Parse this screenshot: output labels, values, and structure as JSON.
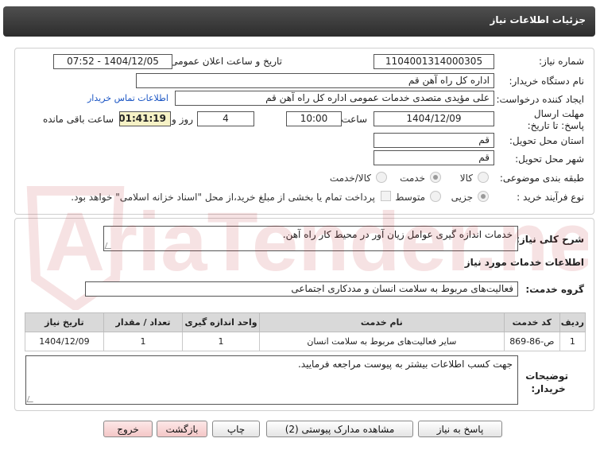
{
  "header": {
    "title": "جزئیات اطلاعات نیاز"
  },
  "form": {
    "need_number": {
      "label": "شماره نیاز:",
      "value": "1104001314000305"
    },
    "announce_datetime": {
      "label": "تاریخ و ساعت اعلان عمومی:",
      "value": "1404/12/05 - 07:52"
    },
    "buyer_org": {
      "label": "نام دستگاه خریدار:",
      "value": "اداره کل  راه آهن قم"
    },
    "requester": {
      "label": "ایجاد کننده درخواست:",
      "value": "علی مؤیدی متصدی خدمات عمومی اداره کل  راه آهن قم",
      "contact_link": "اطلاعات تماس خریدار"
    },
    "deadline": {
      "label": "مهلت ارسال پاسخ: تا تاریخ:",
      "date": "1404/12/09",
      "time_label": "ساعت",
      "time": "10:00",
      "days": "4",
      "days_label": "روز و",
      "remaining": "01:41:19",
      "remaining_label": "ساعت باقی مانده"
    },
    "province": {
      "label": "استان محل تحویل:",
      "value": "قم"
    },
    "city": {
      "label": "شهر محل تحویل:",
      "value": "قم"
    },
    "category": {
      "label": "طبقه بندی موضوعی:",
      "options": [
        "کالا",
        "خدمت",
        "کالا/خدمت"
      ],
      "selected": "خدمت"
    },
    "process": {
      "label": "نوع فرآیند خرید :",
      "options": [
        "جزیی",
        "متوسط"
      ],
      "selected": "جزیی",
      "payment_note": "پرداخت تمام یا بخشی از مبلغ خرید،از محل \"اسناد خزانه اسلامی\" خواهد بود."
    }
  },
  "need_desc": {
    "label": "شرح کلی نیاز:",
    "value": "خدمات اندازه گیری عوامل زیان آور در محیط کار راه آهن."
  },
  "services": {
    "section_title": "اطلاعات خدمات مورد نیاز",
    "group_label": "گروه خدمت:",
    "group_value": "فعالیت‌های مربوط به سلامت انسان و مددکاری اجتماعی",
    "columns": [
      "ردیف",
      "کد خدمت",
      "نام خدمت",
      "واحد اندازه گیری",
      "تعداد / مقدار",
      "تاریخ نیاز"
    ],
    "rows": [
      [
        "1",
        "ص-86-869",
        "سایر فعالیت‌های مربوط به سلامت انسان",
        "1",
        "1",
        "1404/12/09"
      ]
    ]
  },
  "buyer_notes": {
    "label": "توضیحات خریدار:",
    "value": "جهت کسب اطلاعات بیشتر به پیوست مراجعه فرمایید."
  },
  "buttons": {
    "reply": "پاسخ به نیاز",
    "docs": "مشاهده مدارک پیوستی (2)",
    "print": "چاپ",
    "back": "بازگشت",
    "exit": "خروج"
  },
  "colors": {
    "header_bg": "#3a3a3a",
    "remaining_bg": "#f6f2c6",
    "link": "#1a55c4",
    "watermark": "#c0262d"
  }
}
